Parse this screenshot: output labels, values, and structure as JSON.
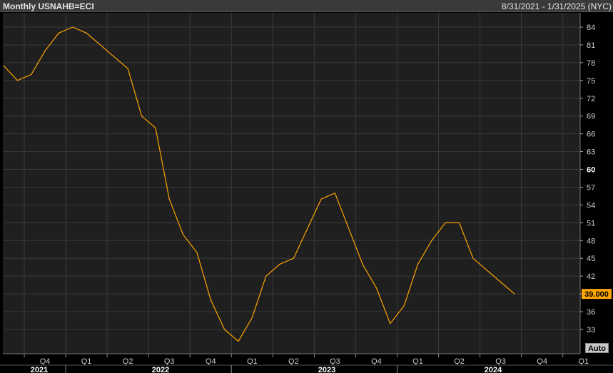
{
  "header": {
    "title": "Monthly USNAHB=ECI",
    "range": "8/31/2021 - 1/31/2025 (NYC)"
  },
  "auto_label": "Auto",
  "colors": {
    "background": "#1f1f1f",
    "line": "#ffa500",
    "grid": "#3a3a3a",
    "last_value_badge": "#ffa500"
  },
  "chart_data": {
    "type": "line",
    "title": "Monthly USNAHB=ECI",
    "series": [
      {
        "x": [
          "2021-08",
          "2021-09",
          "2021-10",
          "2021-11",
          "2021-12",
          "2022-01",
          "2022-02",
          "2022-03",
          "2022-04",
          "2022-05",
          "2022-06",
          "2022-07",
          "2022-08",
          "2022-09",
          "2022-10",
          "2022-11",
          "2022-12",
          "2023-01",
          "2023-02",
          "2023-03",
          "2023-04",
          "2023-05",
          "2023-06",
          "2023-07",
          "2023-08",
          "2023-09",
          "2023-10",
          "2023-11",
          "2023-12",
          "2024-01",
          "2024-02",
          "2024-03",
          "2024-04",
          "2024-05",
          "2024-06",
          "2024-07",
          "2024-08",
          "2024-09"
        ],
        "values": [
          77.5,
          75,
          76,
          80,
          83,
          84,
          83,
          81,
          79,
          77,
          69,
          67,
          55,
          49,
          46,
          38,
          33,
          31,
          35,
          42,
          44,
          45,
          50,
          55,
          56,
          50,
          44,
          40,
          34,
          37,
          44,
          48,
          51,
          51,
          45,
          43,
          41,
          39
        ]
      }
    ],
    "y_ticks": [
      33,
      36,
      39,
      42,
      45,
      48,
      51,
      54,
      57,
      60,
      63,
      66,
      69,
      72,
      75,
      78,
      81,
      84
    ],
    "y_ticks_bold": [
      60
    ],
    "y_tick_labels_hidden_by_badge": [
      39
    ],
    "ylim": [
      30,
      86
    ],
    "last_value_label": "39.000",
    "x_quarter_labels": [
      "Q4",
      "Q1",
      "Q2",
      "Q3",
      "Q4",
      "Q1",
      "Q2",
      "Q3",
      "Q4",
      "Q1",
      "Q2",
      "Q3",
      "Q4",
      "Q1"
    ],
    "x_year_labels": [
      "2021",
      "2022",
      "2023",
      "2024"
    ],
    "grid": true,
    "y_axis_side": "right"
  }
}
